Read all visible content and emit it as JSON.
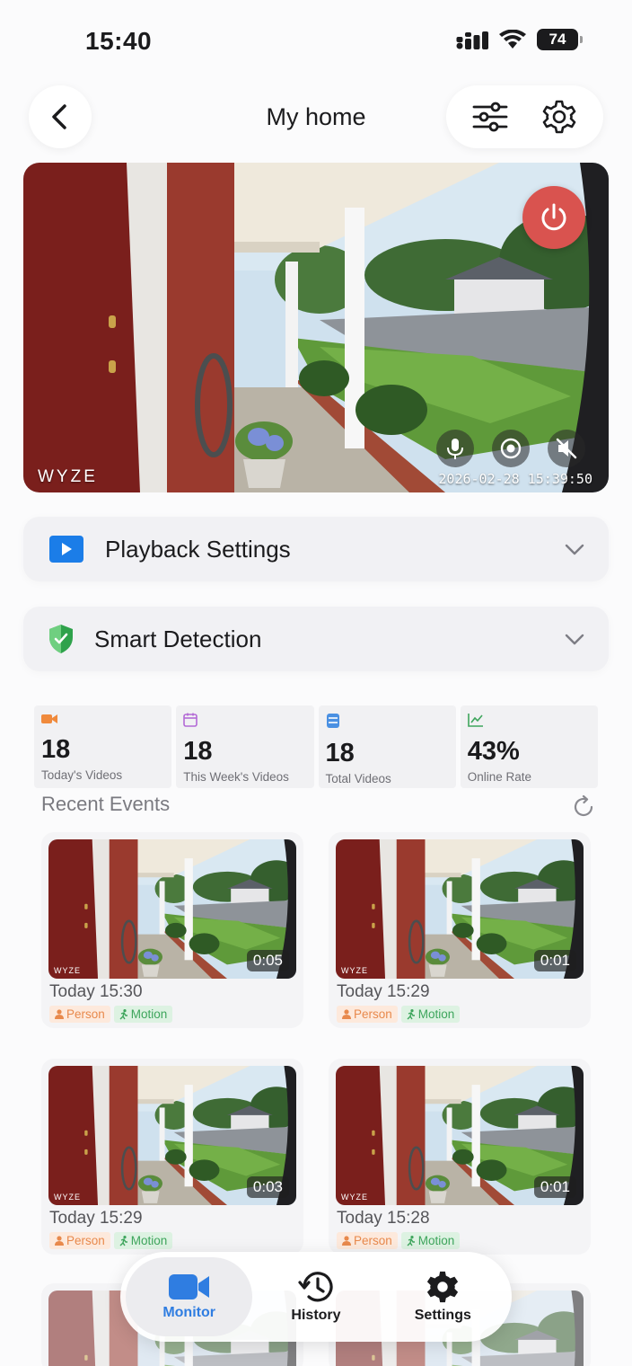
{
  "status_bar": {
    "time": "15:40",
    "battery": "74"
  },
  "header": {
    "title": "My home",
    "back_icon": "chevron-left-icon",
    "filter_icon": "sliders-icon",
    "settings_icon": "gear-icon"
  },
  "live_view": {
    "brand": "WYZE",
    "timestamp": "2026-02-28 15:39:50",
    "power_color": "#d9534f",
    "controls": [
      "microphone-icon",
      "record-icon",
      "speaker-muted-icon"
    ]
  },
  "sections": {
    "playback": {
      "label": "Playback Settings",
      "icon": "play-icon"
    },
    "smart": {
      "label": "Smart Detection",
      "icon": "shield-check-icon"
    }
  },
  "stats": [
    {
      "value": "18",
      "label": "Today's Videos",
      "icon": "video-icon",
      "color": "#f08a3c"
    },
    {
      "value": "18",
      "label": "This Week's Videos",
      "icon": "calendar-icon",
      "color": "#b36ad6"
    },
    {
      "value": "18",
      "label": "Total Videos",
      "icon": "database-icon",
      "color": "#4a90e2"
    },
    {
      "value": "43%",
      "label": "Online Rate",
      "icon": "trend-icon",
      "color": "#3ea55c"
    }
  ],
  "recent_events": {
    "title": "Recent Events",
    "items": [
      {
        "time": "Today 15:30",
        "duration": "0:05",
        "tags": [
          "Person",
          "Motion"
        ]
      },
      {
        "time": "Today 15:29",
        "duration": "0:01",
        "tags": [
          "Person",
          "Motion"
        ]
      },
      {
        "time": "Today 15:29",
        "duration": "0:03",
        "tags": [
          "Person",
          "Motion"
        ]
      },
      {
        "time": "Today 15:28",
        "duration": "0:01",
        "tags": [
          "Person",
          "Motion"
        ]
      }
    ]
  },
  "bottom_nav": {
    "monitor": "Monitor",
    "history": "History",
    "settings": "Settings",
    "active": "monitor",
    "accent": "#2f7de1"
  }
}
